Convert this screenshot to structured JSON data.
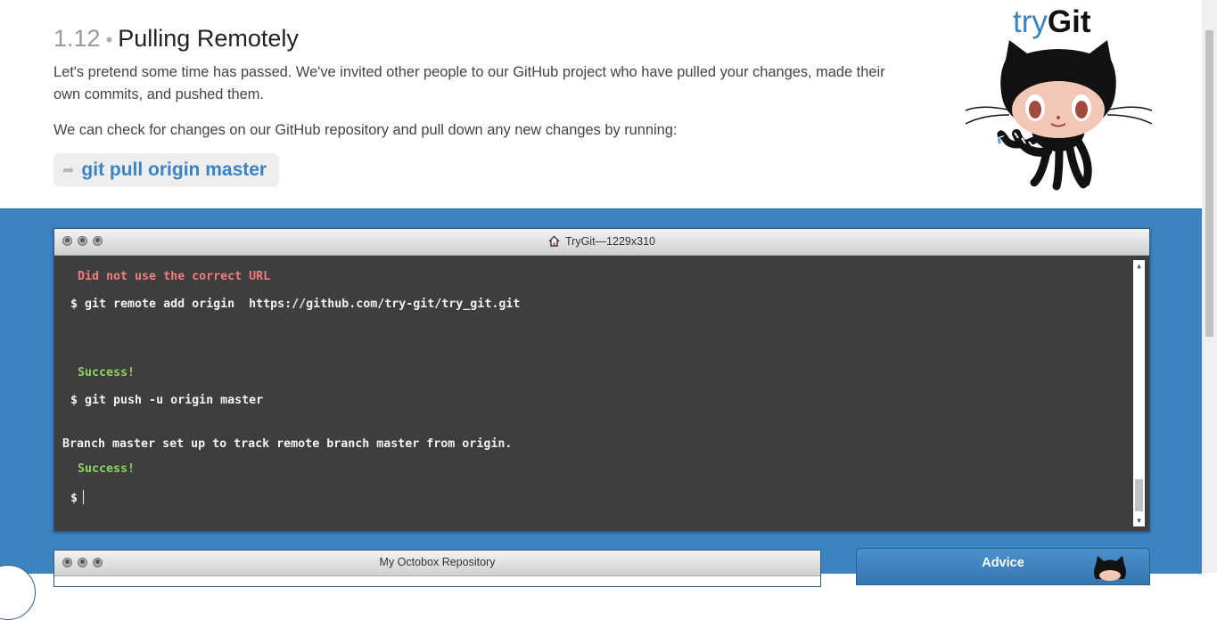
{
  "lesson": {
    "number": "1.12",
    "separator": "•",
    "title": "Pulling Remotely",
    "paragraph1": "Let's pretend some time has passed. We've invited other people to our GitHub project who have pulled your changes, made their own commits, and pushed them.",
    "paragraph2": "We can check for changes on our GitHub repository and pull down any new changes by running:",
    "command": "git pull origin master",
    "command_icon": "arrow-icon"
  },
  "logo": {
    "try": "try",
    "git": "Git"
  },
  "console": {
    "title": "TryGit—1229x310",
    "lines": [
      {
        "text": "Did not use the correct URL",
        "kind": "error"
      },
      {
        "text": "$ git remote add origin  https://github.com/try-git/try_git.git",
        "kind": "command"
      },
      {
        "text": "Success!",
        "kind": "success"
      },
      {
        "text": "$ git push -u origin master",
        "kind": "command"
      },
      {
        "text": "Branch master set up to track remote branch master from origin.",
        "kind": "output"
      },
      {
        "text": "Success!",
        "kind": "success"
      },
      {
        "text": "$",
        "kind": "prompt"
      }
    ]
  },
  "repository": {
    "title": "My Octobox Repository"
  },
  "advice": {
    "title": "Advice"
  },
  "colors": {
    "accent": "#3b83c1",
    "error": "#ef7e7e",
    "success": "#8ed15f",
    "terminal_bg": "#3e3e3e"
  }
}
